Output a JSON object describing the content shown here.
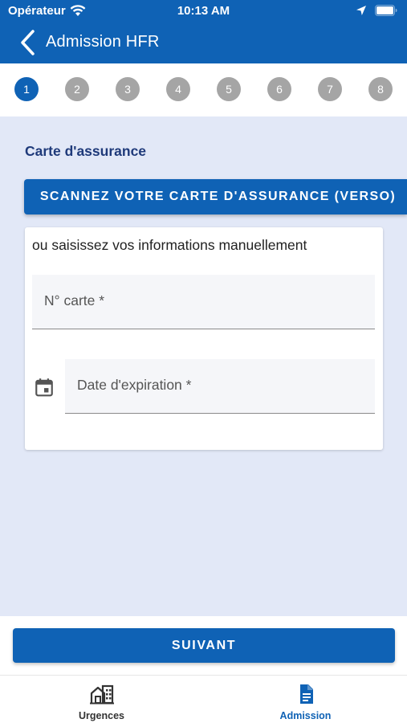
{
  "status_bar": {
    "carrier": "Opérateur",
    "time": "10:13 AM"
  },
  "header": {
    "title": "Admission HFR"
  },
  "stepper": {
    "steps": [
      "1",
      "2",
      "3",
      "4",
      "5",
      "6",
      "7",
      "8"
    ],
    "current_step": 1
  },
  "main": {
    "section_title": "Carte d'assurance",
    "scan_button_label": "SCANNEZ VOTRE CARTE D'ASSURANCE (VERSO)",
    "manual_label": "ou saisissez vos informations manuellement",
    "card_number_label": "N° carte *",
    "expiry_label": "Date d'expiration *"
  },
  "bottom": {
    "next_button_label": "SUIVANT"
  },
  "tabbar": {
    "tabs": [
      {
        "label": "Urgences",
        "icon": "hospital-building-icon",
        "active": false
      },
      {
        "label": "Admission",
        "icon": "document-icon",
        "active": true
      }
    ]
  },
  "colors": {
    "primary": "#0f62b5",
    "background": "#e2e8f7",
    "section_title": "#1f3a7a",
    "step_inactive": "#a5a5a5"
  }
}
